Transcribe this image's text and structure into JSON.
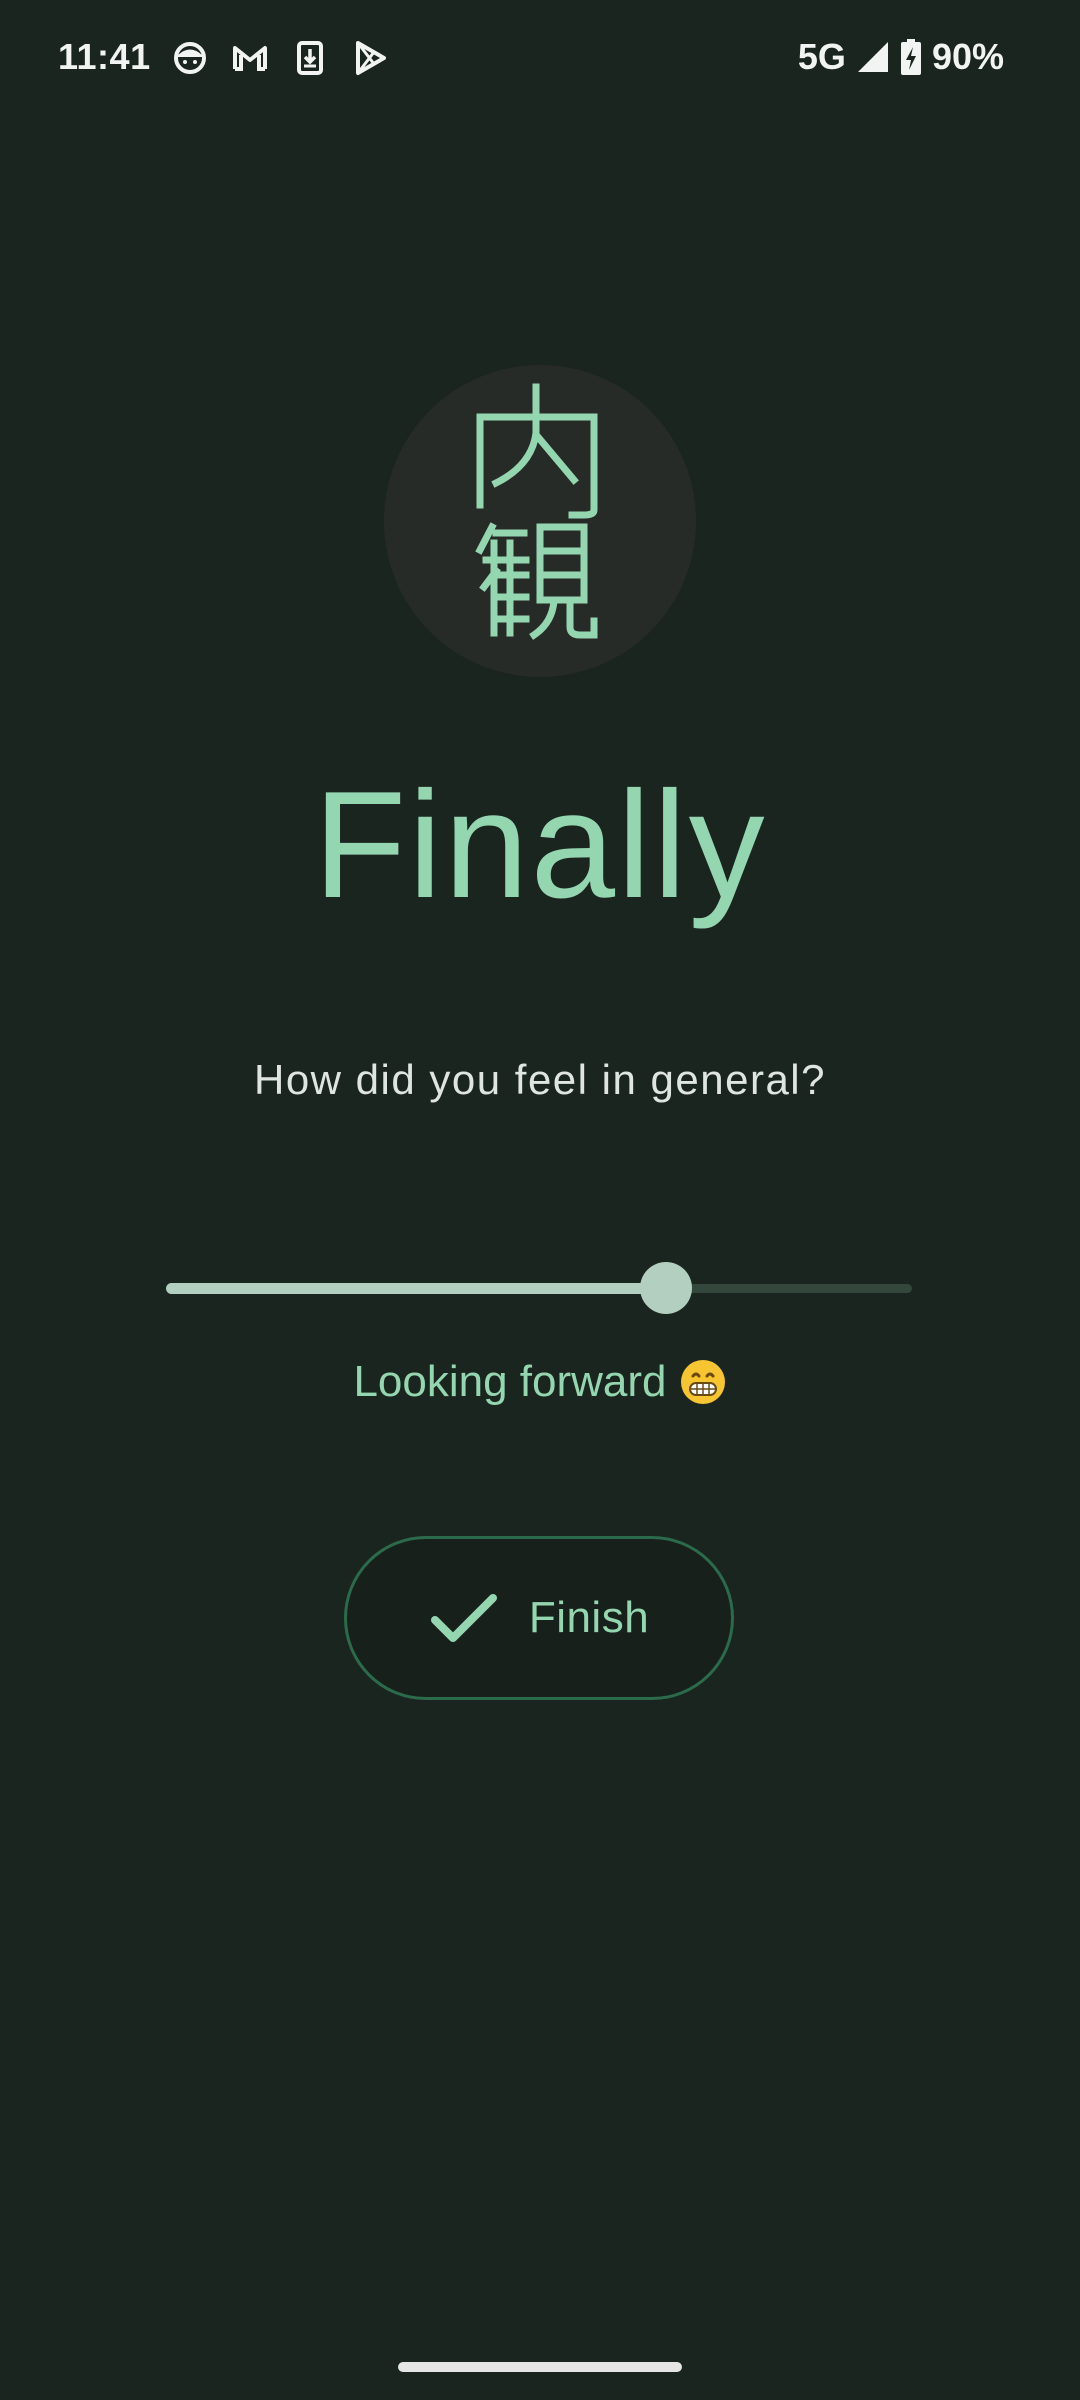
{
  "status_bar": {
    "time": "11:41",
    "notification_icons": [
      "face-icon",
      "gmail-icon",
      "download-icon",
      "play-store-icon"
    ],
    "network": "5G",
    "battery": "90%",
    "battery_level": 0.9
  },
  "logo": {
    "icon": "kanji-logo-icon",
    "background_color": "#272b28",
    "glyph_color": "#94d6b0"
  },
  "title": "Finally",
  "question": "How did you feel in general?",
  "slider": {
    "value": 0.67,
    "thumb_color": "#b3cfc0",
    "track_color": "#34473d"
  },
  "mood": {
    "label": "Looking forward",
    "emoji_icon": "grinning-face-icon"
  },
  "finish_button": {
    "label": "Finish",
    "icon": "check-icon"
  },
  "colors": {
    "background": "#1b2520",
    "accent": "#94d6b0",
    "button_border": "#2b6a4a"
  }
}
